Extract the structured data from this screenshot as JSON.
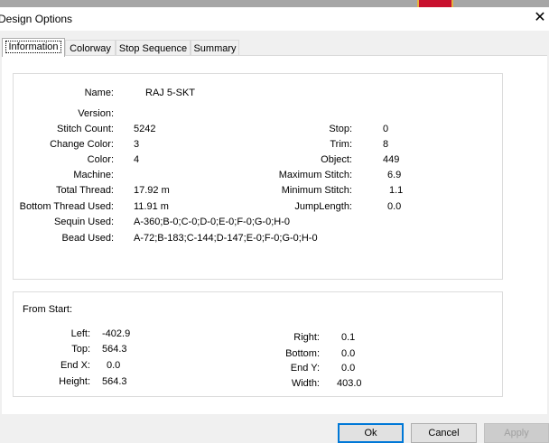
{
  "window": {
    "title": "Design Options"
  },
  "tabs": [
    {
      "label": "Information"
    },
    {
      "label": "Colorway"
    },
    {
      "label": "Stop Sequence"
    },
    {
      "label": "Summary"
    }
  ],
  "info": {
    "name_label": "Name:",
    "name": "RAJ 5-SKT",
    "version_label": "Version:",
    "version": "",
    "stitch_count_label": "Stitch Count:",
    "stitch_count": "5242",
    "change_color_label": "Change Color:",
    "change_color": "3",
    "color_label": "Color:",
    "color": "4",
    "machine_label": "Machine:",
    "machine": "",
    "total_thread_label": "Total Thread:",
    "total_thread": "17.92 m",
    "bottom_thread_label": "Bottom Thread Used:",
    "bottom_thread": "11.91 m",
    "sequin_label": "Sequin Used:",
    "sequin": "A-360;B-0;C-0;D-0;E-0;F-0;G-0;H-0",
    "bead_label": "Bead Used:",
    "bead": "A-72;B-183;C-144;D-147;E-0;F-0;G-0;H-0",
    "stop_label": "Stop:",
    "stop": "0",
    "trim_label": "Trim:",
    "trim": "8",
    "object_label": "Object:",
    "object": "449",
    "max_stitch_label": "Maximum Stitch:",
    "max_stitch": "6.9",
    "min_stitch_label": "Minimum Stitch:",
    "min_stitch": "1.1",
    "jump_label": "JumpLength:",
    "jump": "0.0"
  },
  "from_start": {
    "title": "From Start:",
    "left_label": "Left:",
    "left": "-402.9",
    "top_label": "Top:",
    "top": "564.3",
    "endx_label": "End X:",
    "endx": "0.0",
    "height_label": "Height:",
    "height": "564.3",
    "right_label": "Right:",
    "right": "0.1",
    "bottom_label": "Bottom:",
    "bottom": "0.0",
    "endy_label": "End Y:",
    "endy": "0.0",
    "width_label": "Width:",
    "width": "403.0"
  },
  "buttons": {
    "ok": "Ok",
    "cancel": "Cancel",
    "apply": "Apply"
  }
}
